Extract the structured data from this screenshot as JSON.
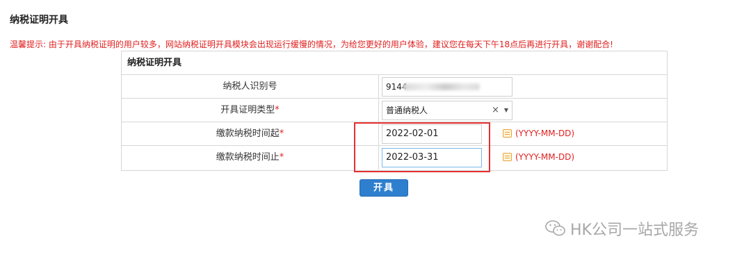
{
  "page": {
    "title": "纳税证明开具",
    "notice": "温馨提示: 由于开具纳税证明的用户较多，网站纳税证明开具模块会出现运行缓慢的情况，为给您更好的用户体验，建议您在每天下午18点后再进行开具，谢谢配合!"
  },
  "form": {
    "header": "纳税证明开具",
    "rows": [
      {
        "label": "纳税人识别号",
        "value": "9144"
      },
      {
        "label": "开具证明类型",
        "value": "普通纳税人",
        "clear": "×",
        "caret": "▼"
      },
      {
        "label": "缴款纳税时间起",
        "value": "2022-02-01",
        "format": "(YYYY-MM-DD)"
      },
      {
        "label": "缴款纳税时间止",
        "value": "2022-03-31",
        "format": "(YYYY-MM-DD)"
      }
    ],
    "required_mark": "*",
    "submit_label": "开具"
  },
  "watermark": {
    "text": "HK公司一站式服务",
    "icon": "wechat-icon"
  },
  "colors": {
    "accent": "#2f7fcf",
    "warning": "#e02020",
    "highlight": "#e53030",
    "calendar": "#e6a23c"
  }
}
